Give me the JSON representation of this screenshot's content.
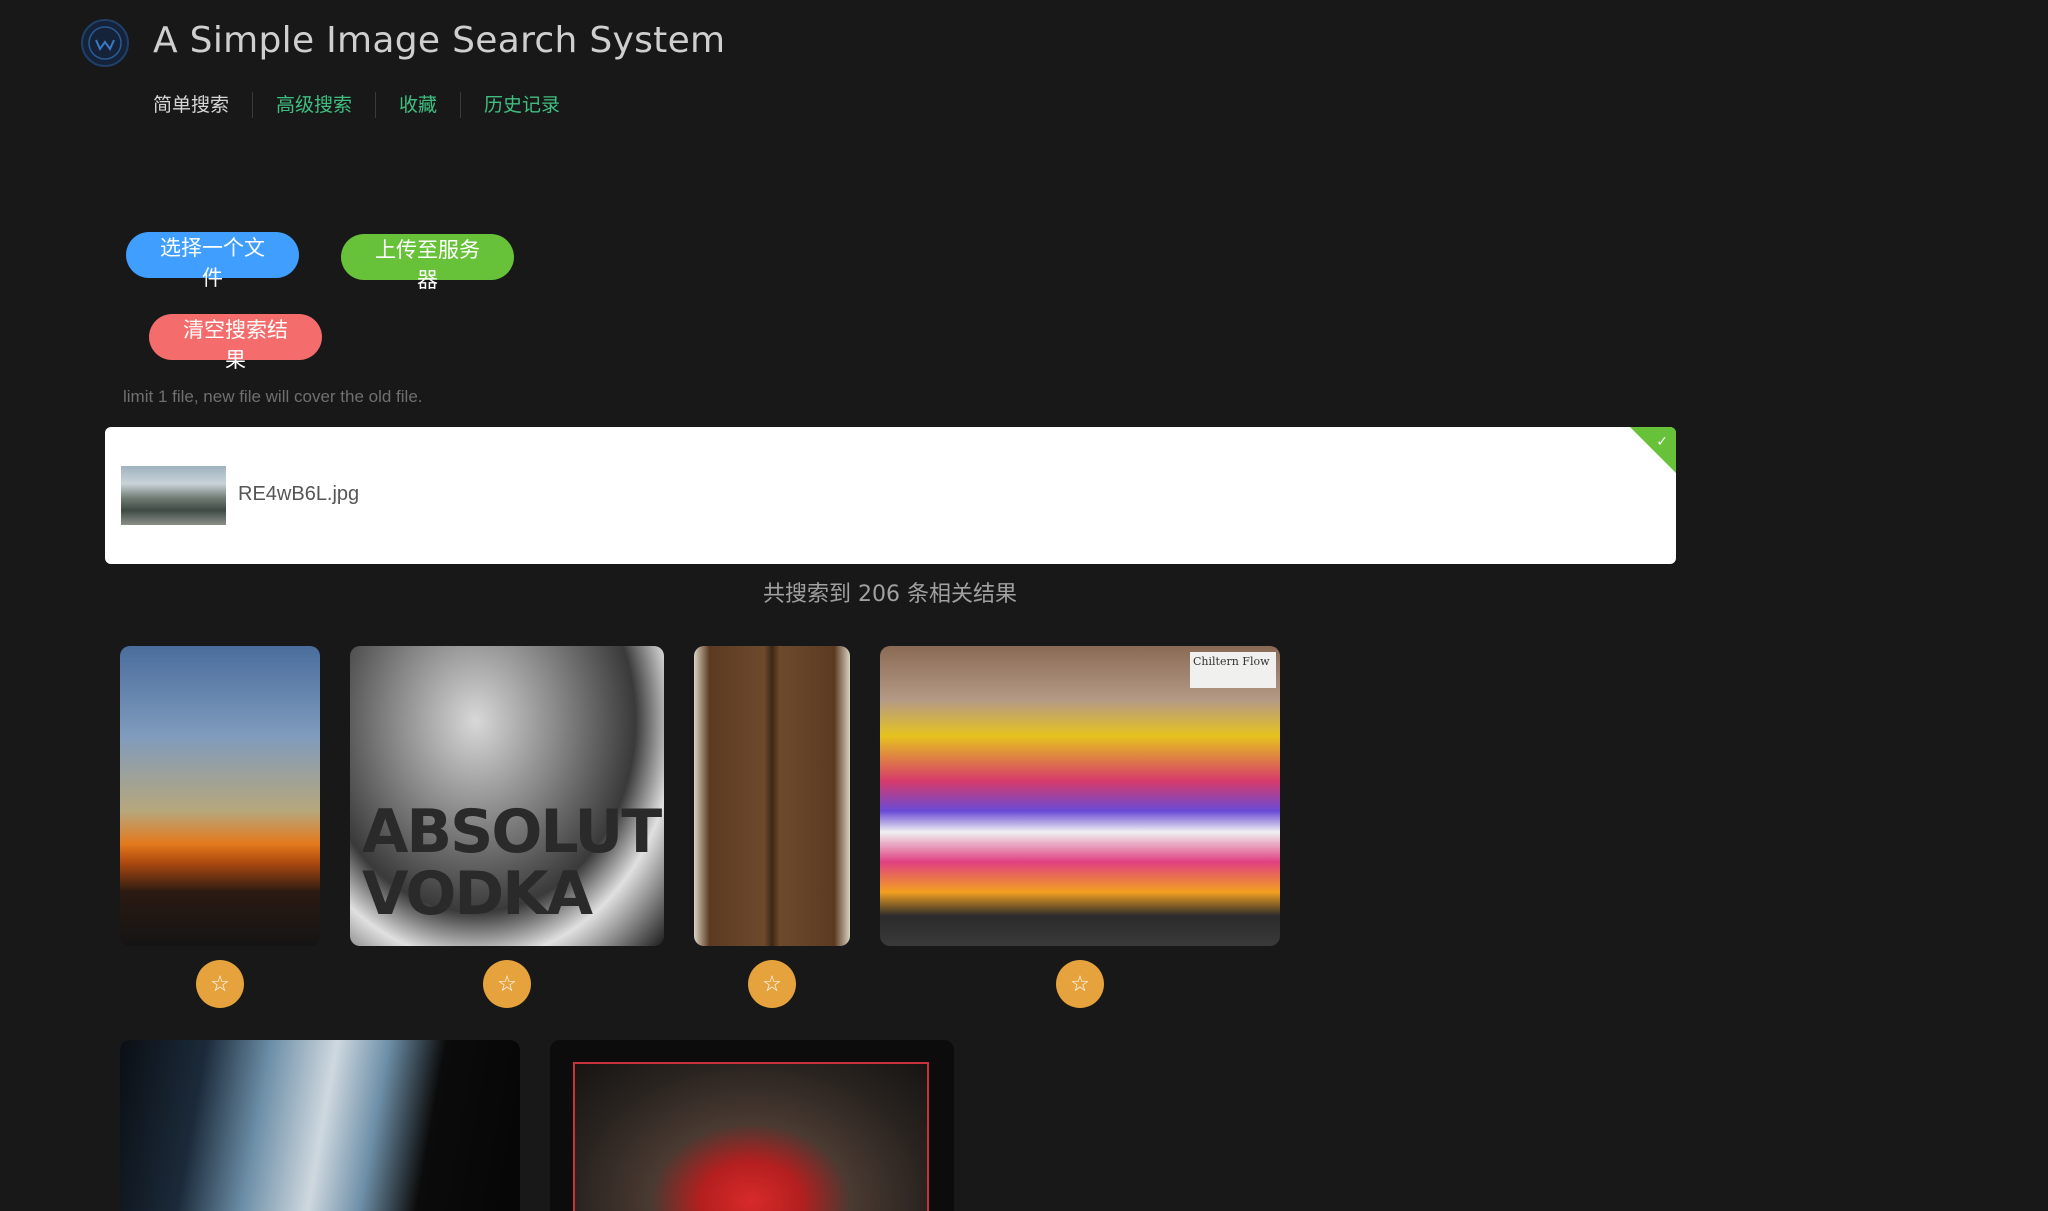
{
  "header": {
    "title": "A Simple Image Search System",
    "nav": [
      {
        "label": "简单搜索",
        "active": true
      },
      {
        "label": "高级搜索",
        "active": false
      },
      {
        "label": "收藏",
        "active": false
      },
      {
        "label": "历史记录",
        "active": false
      }
    ]
  },
  "upload": {
    "choose_label": "选择一个文件",
    "upload_label": "上传至服务器",
    "clear_label": "清空搜索结果",
    "tip": "limit 1 file, new file will cover the old file.",
    "file_name": "RE4wB6L.jpg",
    "status": "success"
  },
  "results": {
    "summary": "共搜索到 206 条相关结果",
    "favorite_icon": "star-icon",
    "images": [
      {
        "subject": "sunset-silhouette",
        "has_favorite": true
      },
      {
        "subject": "absolut-vodka-bottle",
        "text": "ABSOLUT\nVODKA",
        "has_favorite": true
      },
      {
        "subject": "wooden-door",
        "has_favorite": true
      },
      {
        "subject": "flower-stall",
        "sign": "Chiltern Flow",
        "has_favorite": true
      },
      {
        "subject": "night-building",
        "has_favorite": false
      },
      {
        "subject": "red-lily",
        "has_favorite": false
      }
    ]
  },
  "colors": {
    "background": "#181818",
    "primary": "#409eff",
    "success": "#67c23a",
    "danger": "#f56c6c",
    "warning": "#e6a23c",
    "nav_link": "#3fbf7f"
  }
}
